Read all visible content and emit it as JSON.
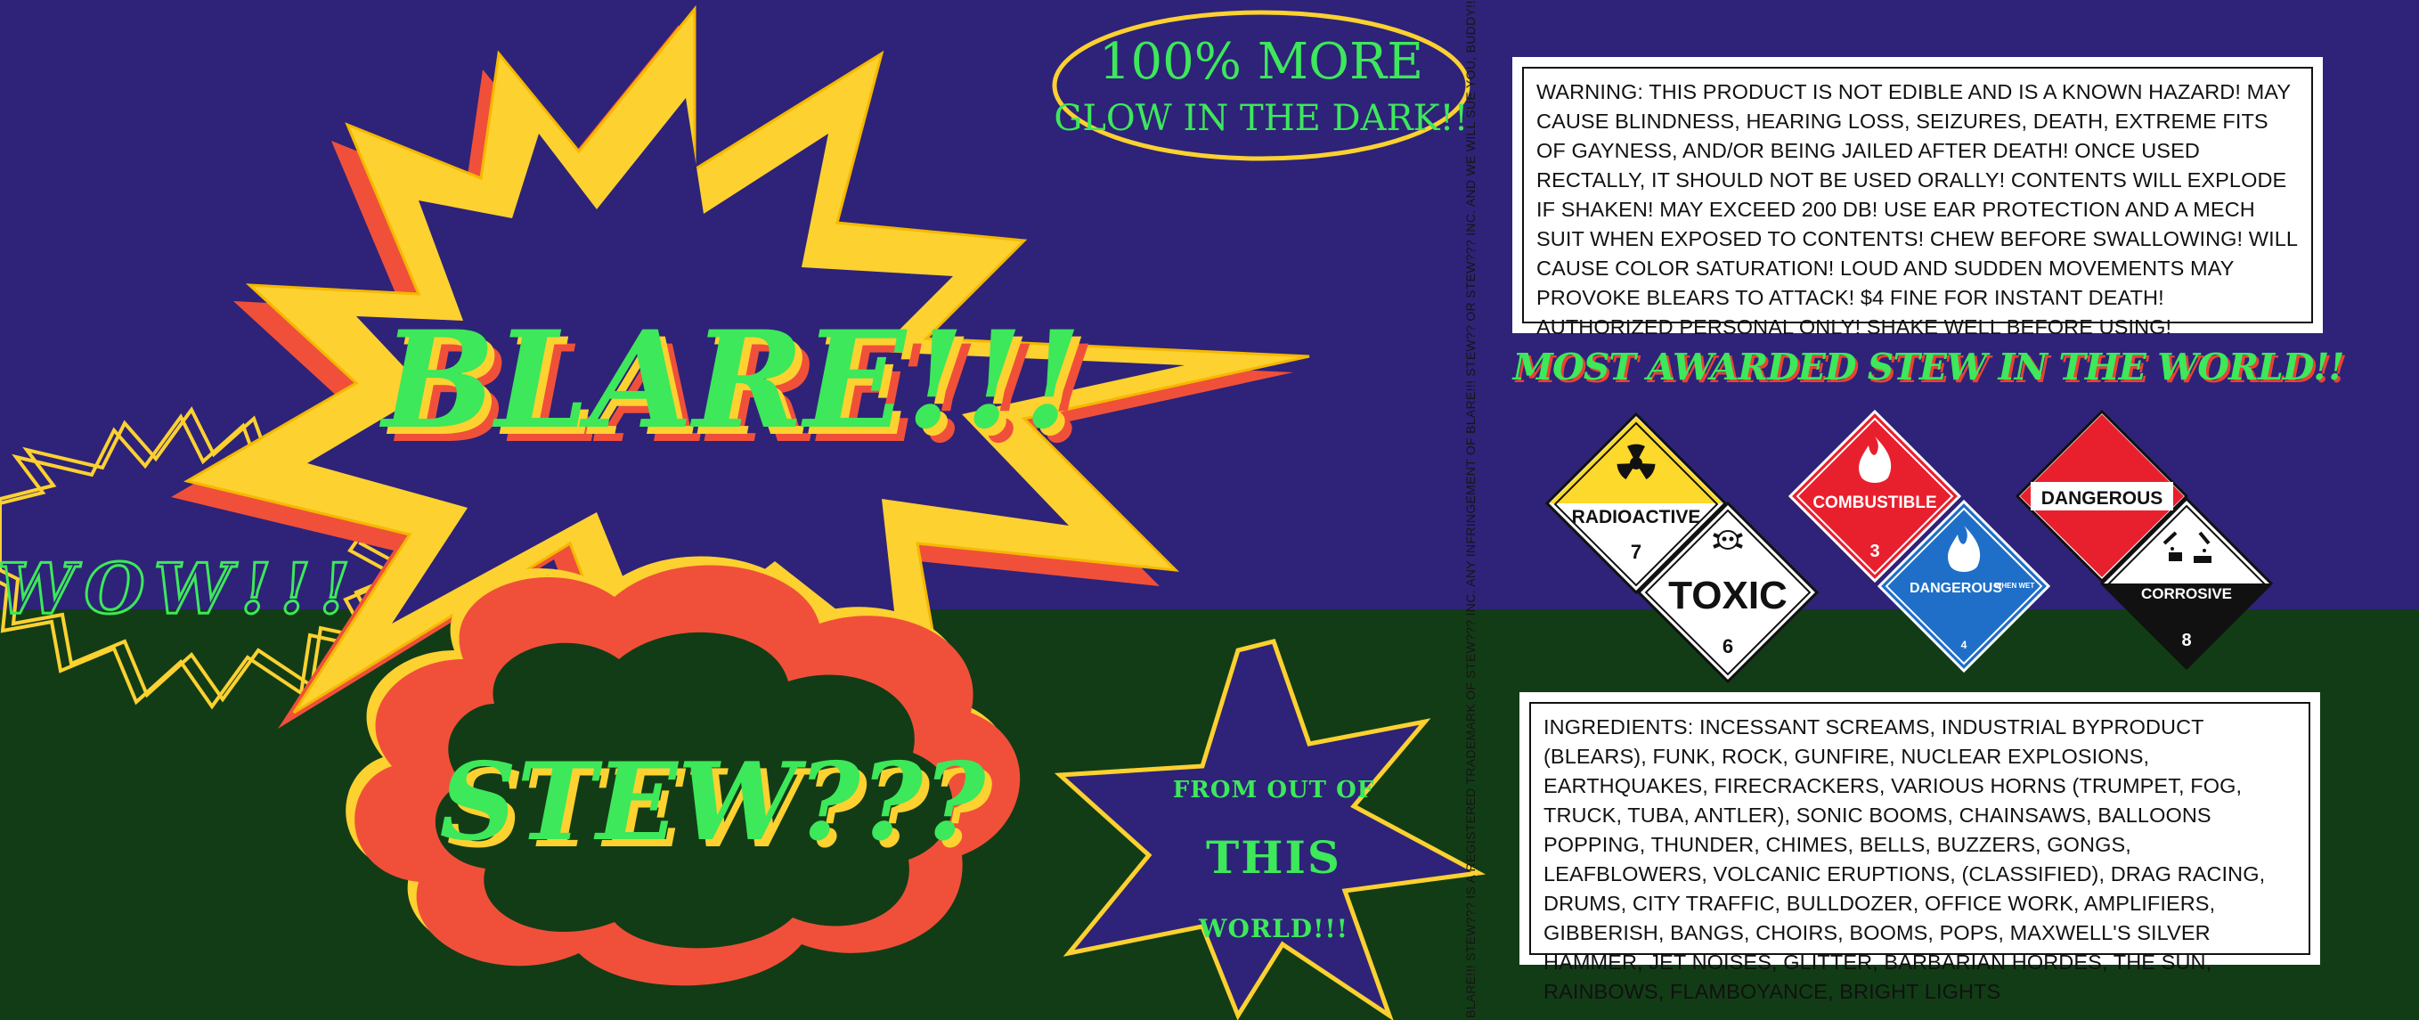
{
  "brand": {
    "title": "BLARE!!!",
    "subtitle": "STEW???",
    "exclaim": "WOW!!!",
    "glow_line1": "100% MORE",
    "glow_line2": "GLOW IN THE DARK!!",
    "origin_line1": "FROM OUT OF",
    "origin_line2": "THIS",
    "origin_line3": "WORLD!!!"
  },
  "spine_text": "BLARE!!! STEW??? IS A REGISTERED TRADEMARK OF STEW??? INC. ANY INFRINGEMENT OF BLARE!!! STEW?? OR STEW??? INC. AND WE WILL SUE YOU, BUDDY!!",
  "warning": "WARNING: THIS PRODUCT IS NOT EDIBLE AND IS A KNOWN HAZARD! MAY CAUSE BLINDNESS, HEARING LOSS, SEIZURES, DEATH, EXTREME FITS OF GAYNESS, AND/OR BEING JAILED AFTER DEATH! ONCE USED RECTALLY, IT SHOULD NOT BE USED ORALLY! CONTENTS WILL EXPLODE IF SHAKEN! MAY EXCEED 200 dB! USE EAR PROTECTION AND A MECH SUIT WHEN EXPOSED TO CONTENTS! CHEW BEFORE SWALLOWING! WILL CAUSE COLOR SATURATION! LOUD AND SUDDEN MOVEMENTS MAY PROVOKE BLEARS TO ATTACK! $4 FINE FOR INSTANT DEATH! AUTHORIZED PERSONAL ONLY! SHAKE WELL BEFORE USING!",
  "award": "MOST AWARDED STEW IN THE WORLD!!",
  "placards": {
    "radioactive": {
      "label": "RADIOACTIVE",
      "class": "7"
    },
    "toxic": {
      "label": "TOXIC",
      "class": "6"
    },
    "combustible": {
      "label": "COMBUSTIBLE",
      "class": "3"
    },
    "dangerous_when_wet": {
      "label": "DANGEROUS",
      "note": "WHEN WET",
      "class": "4"
    },
    "dangerous": {
      "label": "DANGEROUS"
    },
    "corrosive": {
      "label": "CORROSIVE",
      "class": "8"
    }
  },
  "ingredients": "INGREDIENTS: INCESSANT SCREAMS, INDUSTRIAL BYPRODUCT (BLEARS), FUNK, ROCK, GUNFIRE, NUCLEAR EXPLOSIONS, EARTHQUAKES, FIRECRACKERS, VARIOUS HORNS (TRUMPET, FOG, TRUCK, TUBA, ANTLER), SONIC BOOMS, CHAINSAWS, BALLOONS POPPING, THUNDER, CHIMES, BELLS, BUZZERS, GONGS, LEAFBLOWERS, VOLCANIC ERUPTIONS, (CLASSIFIED), DRAG RACING, DRUMS, CITY TRAFFIC, BULLDOZER, OFFICE WORK, AMPLIFIERS, GIBBERISH, BANGS, CHOIRS, BOOMS, POPS, MAXWELL'S SILVER HAMMER, JET NOISES, GLITTER, BARBARIAN HORDES, THE SUN, RAINBOWS, FLAMBOYANCE, BRIGHT LIGHTS",
  "colors": {
    "purple": "#2e2378",
    "green_bg": "#123c16",
    "neon_green": "#3de85a",
    "yellow": "#fcd130",
    "red": "#f0503a"
  }
}
